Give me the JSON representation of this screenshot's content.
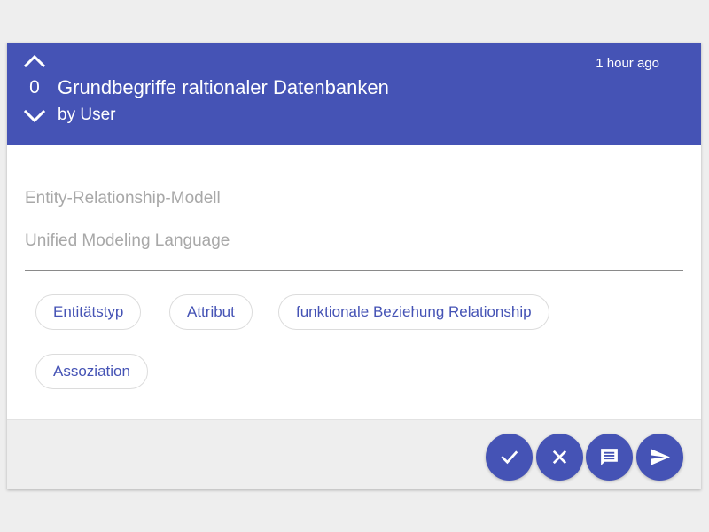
{
  "card": {
    "vote_count": "0",
    "title": "Grundbegriffe raltionaler Datenbanken",
    "author": "by User",
    "timestamp": "1 hour ago",
    "fields": [
      "Entity-Relationship-Modell",
      "Unified Modeling Language"
    ],
    "tags": [
      "Entitätstyp",
      "Attribut",
      "funktionale Beziehung Relationship",
      "Assoziation"
    ]
  },
  "icons": {
    "vote_up": "chevron-up-icon",
    "vote_down": "chevron-down-icon",
    "accept": "check-icon",
    "reject": "close-icon",
    "comment": "comment-icon",
    "send": "send-icon"
  },
  "colors": {
    "primary": "#4553b5",
    "background": "#eeeeee",
    "card": "#ffffff",
    "placeholder_text": "#a8a8a8",
    "chip_border": "#dcdcdc"
  }
}
